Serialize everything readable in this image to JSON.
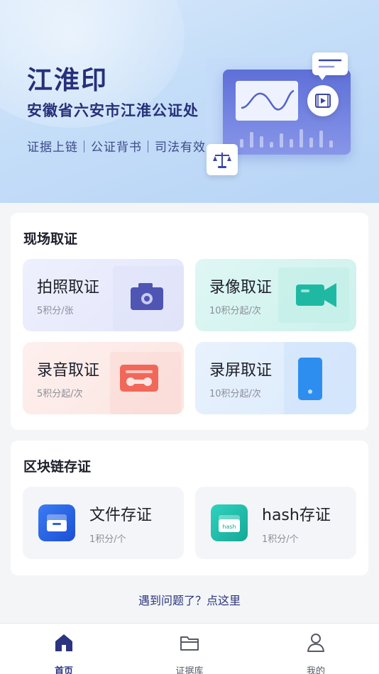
{
  "banner": {
    "title": "江淮印",
    "subtitle": "安徽省六安市江淮公证处",
    "tags": "证据上链｜公证背书｜司法有效"
  },
  "field_section": {
    "title": "现场取证",
    "items": [
      {
        "title": "拍照取证",
        "cost": "5积分/张",
        "icon": "camera-icon"
      },
      {
        "title": "录像取证",
        "cost": "10积分起/次",
        "icon": "video-camera-icon"
      },
      {
        "title": "录音取证",
        "cost": "5积分起/次",
        "icon": "cassette-icon"
      },
      {
        "title": "录屏取证",
        "cost": "10积分起/次",
        "icon": "phone-icon"
      }
    ]
  },
  "chain_section": {
    "title": "区块链存证",
    "items": [
      {
        "title": "文件存证",
        "cost": "1积分/个",
        "icon": "file-inbox-icon"
      },
      {
        "title": "hash存证",
        "cost": "1积分/个",
        "icon": "hash-folder-icon",
        "badge": "hash"
      }
    ]
  },
  "help_link": "遇到问题了？点这里",
  "tabbar": {
    "items": [
      {
        "label": "首页",
        "icon": "home-icon",
        "active": true
      },
      {
        "label": "证据库",
        "icon": "folder-icon",
        "active": false
      },
      {
        "label": "我的",
        "icon": "user-icon",
        "active": false
      }
    ]
  },
  "colors": {
    "brand": "#2b3480",
    "banner_bg": "#c4ddf8",
    "photo_icon": "#4f55b3",
    "video_icon": "#1fb9a3",
    "audio_icon": "#f1685a",
    "screen_icon": "#2d8ef0"
  }
}
